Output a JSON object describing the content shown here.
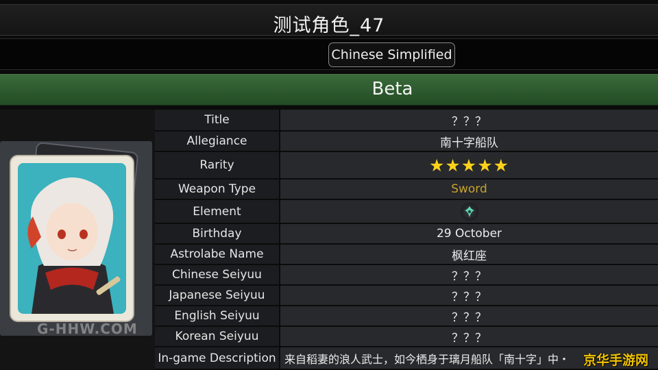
{
  "header": {
    "title": "测试角色_47",
    "language": "Chinese Simplified",
    "status": "Beta"
  },
  "portrait": {
    "watermark": "G-HHW.COM"
  },
  "info": {
    "rows": [
      {
        "label": "Title",
        "value": "？？？"
      },
      {
        "label": "Allegiance",
        "value": "南十字船队"
      },
      {
        "label": "Rarity",
        "value": "★★★★★"
      },
      {
        "label": "Weapon Type",
        "value": "Sword"
      },
      {
        "label": "Element",
        "value": ""
      },
      {
        "label": "Birthday",
        "value": "29 October"
      },
      {
        "label": "Astrolabe Name",
        "value": "枫红座"
      },
      {
        "label": "Chinese Seiyuu",
        "value": "？？？"
      },
      {
        "label": "Japanese Seiyuu",
        "value": "？？？"
      },
      {
        "label": "English Seiyuu",
        "value": "？？？"
      },
      {
        "label": "Korean Seiyuu",
        "value": "？？？"
      },
      {
        "label": "In-game Description",
        "value": "来自稻妻的浪人武士，如今栖身于璃月船队「南十字」中・"
      }
    ],
    "rarity_stars": 5,
    "element_icon": "anemo-icon"
  },
  "site_watermark": "京华手游网",
  "colors": {
    "status_green": "#2f5e30",
    "star_yellow": "#ffd21a",
    "weapon_gold": "#c9a42c",
    "card_teal": "#3bb2bd"
  }
}
